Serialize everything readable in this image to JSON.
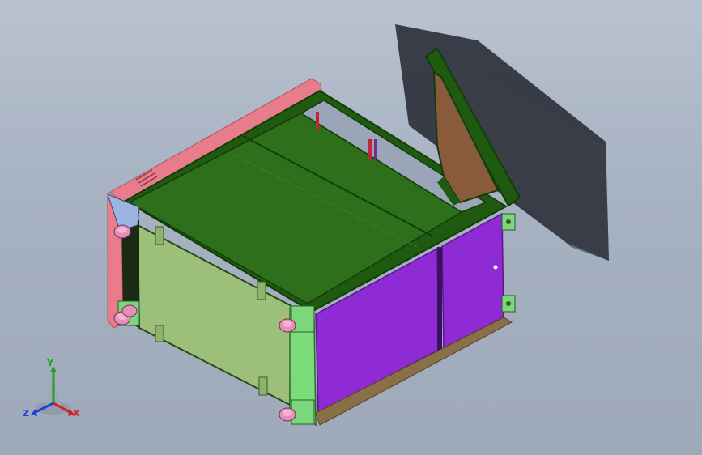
{
  "viewport": {
    "background_top": "#b8c2d0",
    "background_bottom": "#9ea9ba"
  },
  "colors": {
    "top_panel": "#1f5a10",
    "top_panel_light": "#2d6f1a",
    "frame_edge": "#123d0a",
    "front_panel": "#8f2bd4",
    "front_panel_dark": "#6a1aa8",
    "side_glass": "#9cbf7a",
    "side_frame_green": "#7cdc7c",
    "pink_trim": "#e87c8a",
    "door_brown": "#8a5a3c",
    "base_wood": "#8a7048",
    "shadow": "#2a2f38",
    "leveling_foot": "#e48fb8"
  },
  "triad": {
    "x_label": "X",
    "y_label": "Y",
    "z_label": "Z",
    "x_color": "#d42020",
    "y_color": "#20a020",
    "z_color": "#2040d0"
  }
}
